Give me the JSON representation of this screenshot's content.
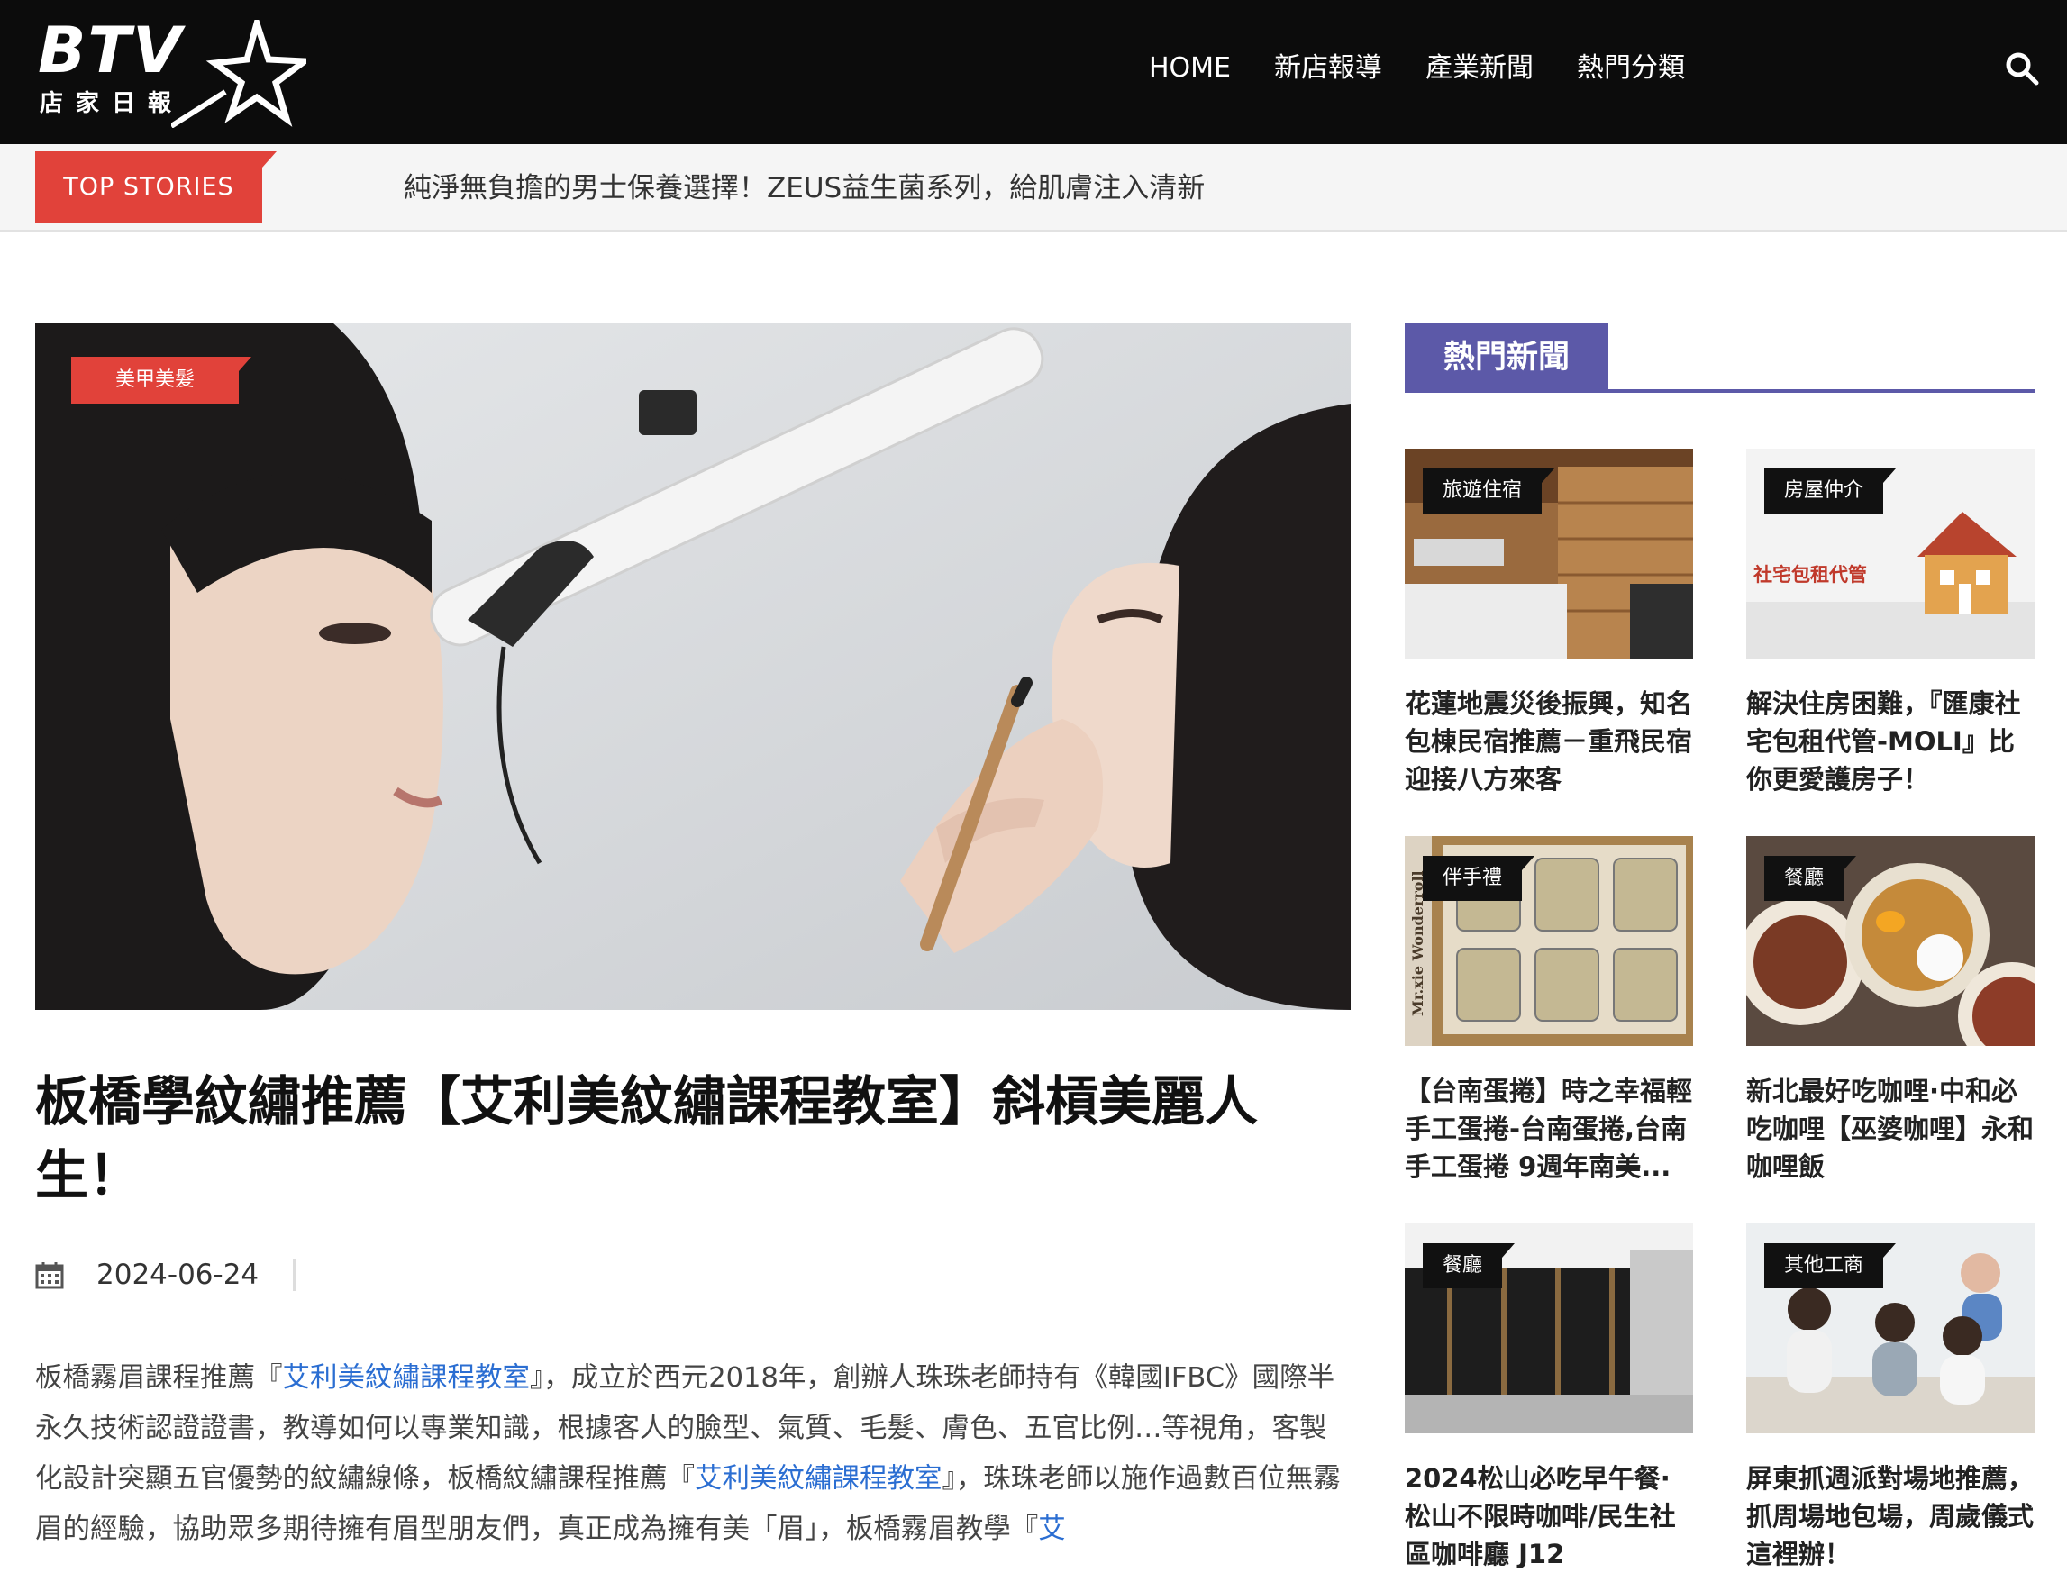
{
  "brand": {
    "logo_text": "BTV",
    "logo_subtitle": "店家日報"
  },
  "nav": {
    "items": [
      "HOME",
      "新店報導",
      "產業新聞",
      "熱門分類"
    ]
  },
  "ticker": {
    "label": "TOP STORIES",
    "headline": "純淨無負擔的男士保養選擇！ZEUS益生菌系列，給肌膚注入清新"
  },
  "article": {
    "category": "美甲美髮",
    "title": "板橋學紋繡推薦【艾利美紋繡課程教室】斜槓美麗人生！",
    "date": "2024-06-24",
    "body": [
      "板橋霧眉課程推薦『",
      "艾利美紋繡課程教室",
      "』，成立於西元2018年，創辦人珠珠老師持有《韓國IFBC》國際半永久技術認證證書，教導如何以專業知識，根據客人的臉型、氣質、毛髮、膚色、五官比例…等視角，客製化設計突顯五官優勢的紋繡線條，板橋紋繡課程推薦『",
      "艾利美紋繡課程教室",
      "』，珠珠老師以施作過數百位無霧眉的經驗，協助眾多期待擁有眉型朋友們，真正成為擁有美「眉」，板橋霧眉教學『",
      "艾"
    ]
  },
  "sidebar": {
    "heading": "熱門新聞",
    "cards": [
      {
        "tag": "旅遊住宿",
        "title": "花蓮地震災後振興，知名包棟民宿推薦－重飛民宿迎接八方來客"
      },
      {
        "tag": "房屋仲介",
        "title": "解決住房困難，『匯康社宅包租代管-MOLI』比你更愛護房子！",
        "image_text": "社宅包租代管"
      },
      {
        "tag": "伴手禮",
        "title": "【台南蛋捲】時之幸福輕手工蛋捲-台南蛋捲,台南手工蛋捲 9週年南美...",
        "image_text": "Mr.xie Wonderroll"
      },
      {
        "tag": "餐廳",
        "title": "新北最好吃咖哩·中和必吃咖哩【巫婆咖哩】永和咖哩飯"
      },
      {
        "tag": "餐廳",
        "title": "2024松山必吃早午餐·松山不限時咖啡/民生社區咖啡廳 J12"
      },
      {
        "tag": "其他工商",
        "title": "屏東抓週派對場地推薦，抓周場地包場，周歲儀式這裡辦！"
      }
    ]
  },
  "colors": {
    "accent_red": "#e1423a",
    "sidebar_purple": "#5c59a8",
    "header_bg": "#0c0c0c",
    "link_blue": "#2b6ed2"
  },
  "icons": {
    "search": "search-icon",
    "calendar": "calendar-icon",
    "logo_star": "star-icon"
  }
}
